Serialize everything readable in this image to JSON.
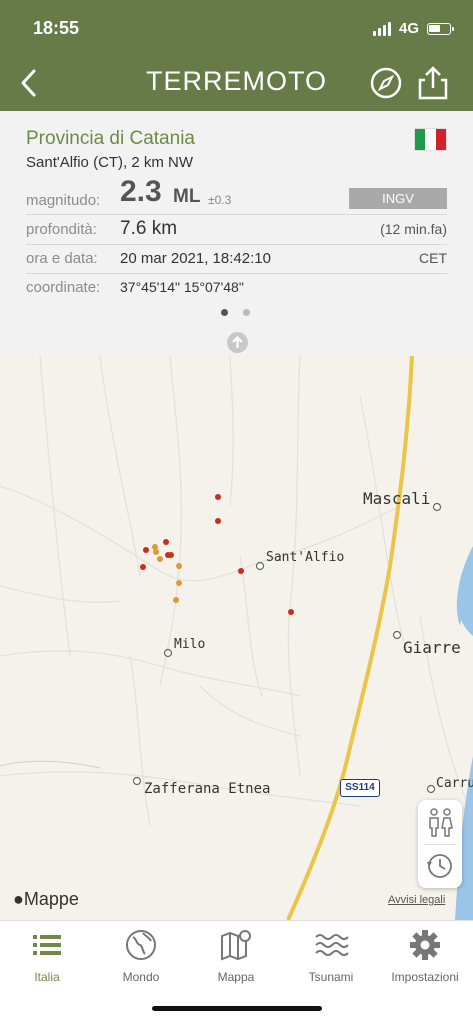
{
  "status": {
    "time": "18:55",
    "network": "4G"
  },
  "header": {
    "title": "TERREMOTO"
  },
  "event": {
    "province": "Provincia di Catania",
    "location": "Sant'Alfio (CT), 2 km NW",
    "magnitude_label": "magnitudo:",
    "magnitude_value": "2.3",
    "magnitude_unit": "ML",
    "magnitude_error": "±0.3",
    "source": "INGV",
    "depth_label": "profondità:",
    "depth_value": "7.6 km",
    "time_ago": "(12 min.fa)",
    "datetime_label": "ora e data:",
    "datetime_value": "20 mar 2021, 18:42:10",
    "timezone": "CET",
    "coords_label": "coordinate:",
    "coords_value": "37°45'14\"  15°07'48\""
  },
  "colors": {
    "header": "#667b48",
    "accent": "#6f8a45",
    "quake_recent": "#cc2b1d",
    "quake_older": "#d99a3b"
  },
  "map": {
    "towns": [
      "Mascali",
      "Sant'Alfio",
      "Milo",
      "Giarre",
      "Zafferana Etnea",
      "Carru"
    ],
    "road_label": "SS114",
    "attribution": "Mappe",
    "legal": "Avvisi legali"
  },
  "tabs": [
    {
      "label": "Italia",
      "icon": "list-icon",
      "active": true
    },
    {
      "label": "Mondo",
      "icon": "globe-icon",
      "active": false
    },
    {
      "label": "Mappa",
      "icon": "map-icon",
      "active": false
    },
    {
      "label": "Tsunami",
      "icon": "waves-icon",
      "active": false
    },
    {
      "label": "Impostazioni",
      "icon": "gear-icon",
      "active": false
    }
  ]
}
